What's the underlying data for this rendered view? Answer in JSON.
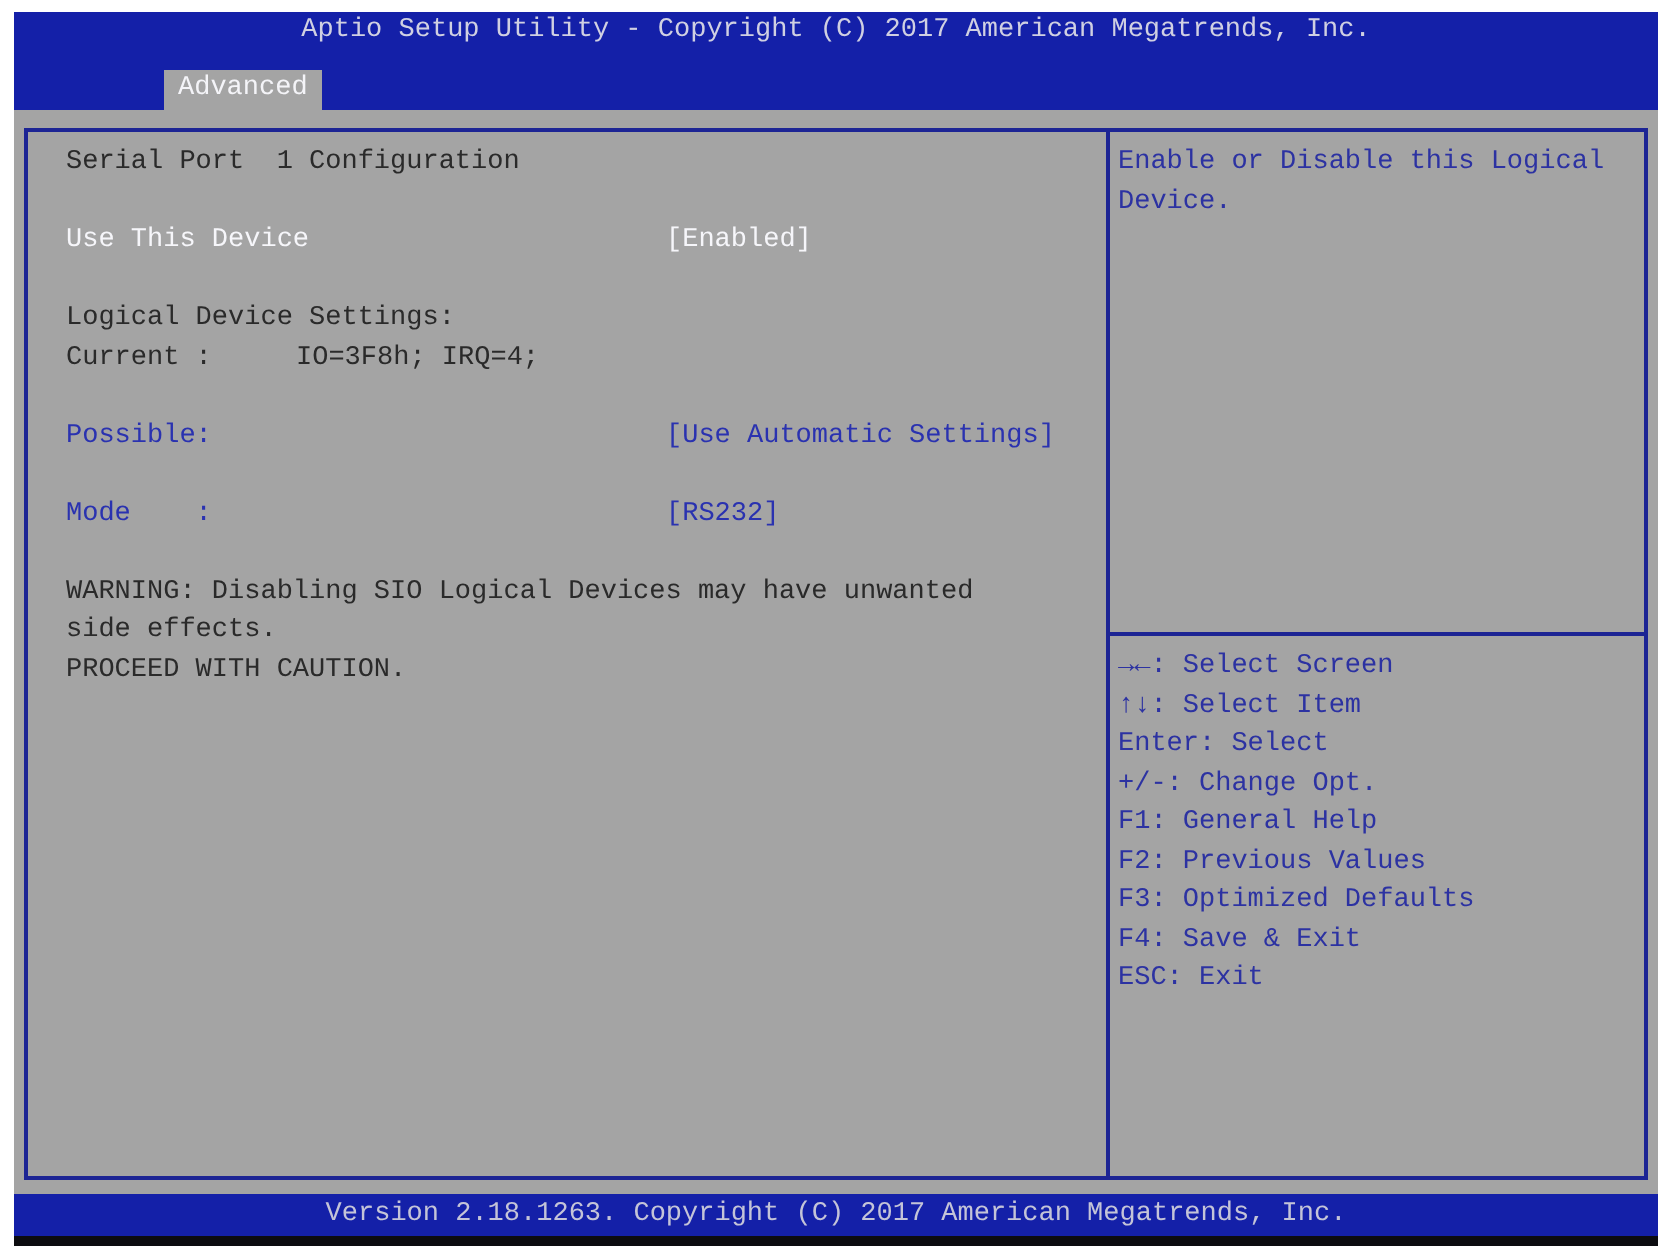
{
  "header": {
    "title": "Aptio Setup Utility - Copyright (C) 2017 American Megatrends, Inc."
  },
  "tabs": [
    {
      "label": "Advanced",
      "selected": true
    }
  ],
  "settings_panel": {
    "sections": [
      {
        "lines": [
          {
            "kind": "heading",
            "text": "Serial Port  1 Configuration"
          }
        ]
      },
      {
        "lines": [
          {
            "kind": "setting",
            "label": "Use This Device",
            "value": "[Enabled]",
            "selected": true
          }
        ]
      },
      {
        "lines": [
          {
            "kind": "text",
            "text": "Logical Device Settings:"
          },
          {
            "kind": "info",
            "label": "Current :",
            "value": "IO=3F8h; IRQ=4;"
          }
        ]
      },
      {
        "lines": [
          {
            "kind": "setting",
            "label": "Possible:",
            "value": "[Use Automatic Settings]",
            "selected": false
          }
        ]
      },
      {
        "lines": [
          {
            "kind": "setting",
            "label": "Mode    :",
            "value": "[RS232]",
            "selected": false
          }
        ]
      },
      {
        "lines": [
          {
            "kind": "warning",
            "text": "WARNING: Disabling SIO Logical Devices may have unwanted side effects."
          },
          {
            "kind": "warning",
            "text": "PROCEED WITH CAUTION."
          }
        ]
      }
    ]
  },
  "help_panel": {
    "description": "Enable or Disable this Logical Device.",
    "key_hints": [
      "→←: Select Screen",
      "↑↓: Select Item",
      "Enter: Select",
      "+/-: Change Opt.",
      "F1: General Help",
      "F2: Previous Values",
      "F3: Optimized Defaults",
      "F4: Save & Exit",
      "ESC: Exit"
    ]
  },
  "footer": {
    "text": "Version 2.18.1263. Copyright (C) 2017 American Megatrends, Inc."
  }
}
